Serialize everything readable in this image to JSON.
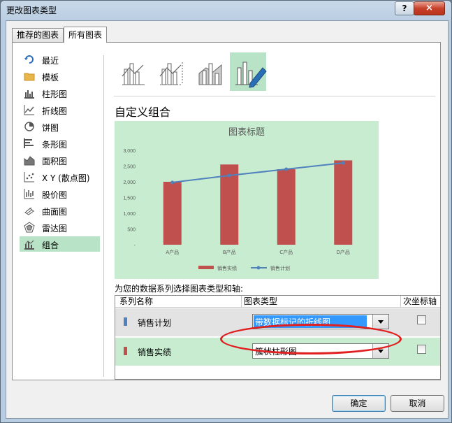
{
  "window": {
    "title": "更改图表类型",
    "help_label": "?",
    "close_label": "×"
  },
  "tabs": [
    {
      "label": "推荐的图表",
      "active": false
    },
    {
      "label": "所有图表",
      "active": true
    }
  ],
  "categories": [
    {
      "label": "最近",
      "icon": "recent-icon"
    },
    {
      "label": "模板",
      "icon": "folder-icon"
    },
    {
      "label": "柱形图",
      "icon": "column-chart-icon"
    },
    {
      "label": "折线图",
      "icon": "line-chart-icon"
    },
    {
      "label": "饼图",
      "icon": "pie-chart-icon"
    },
    {
      "label": "条形图",
      "icon": "bar-chart-icon"
    },
    {
      "label": "面积图",
      "icon": "area-chart-icon"
    },
    {
      "label": "X Y (散点图)",
      "icon": "scatter-chart-icon"
    },
    {
      "label": "股价图",
      "icon": "stock-chart-icon"
    },
    {
      "label": "曲面图",
      "icon": "surface-chart-icon"
    },
    {
      "label": "雷达图",
      "icon": "radar-chart-icon"
    },
    {
      "label": "组合",
      "icon": "combo-chart-icon",
      "selected": true
    }
  ],
  "subtypes": [
    "combo-column-line-icon",
    "combo-column-line-secondary-icon",
    "combo-area-column-icon",
    "custom-combo-icon"
  ],
  "section_title": "自定义组合",
  "chart_data": {
    "type": "bar",
    "title": "图表标题",
    "categories": [
      "A产品",
      "B产品",
      "C产品",
      "D产品"
    ],
    "series": [
      {
        "name": "销售实绩",
        "type": "bar",
        "values": [
          2000,
          2550,
          2400,
          2680
        ],
        "color": "#c0504d"
      },
      {
        "name": "销售计划",
        "type": "line",
        "values": [
          1980,
          2200,
          2400,
          2600
        ],
        "color": "#4f81bd"
      }
    ],
    "ylim": [
      0,
      3000
    ],
    "yticks": [
      "3,000",
      "2,500",
      "2,000",
      "1,500",
      "1,000",
      "500",
      "-"
    ],
    "legend": "bottom",
    "background": "#c8ecd0"
  },
  "series_prompt": "为您的数据系列选择图表类型和轴:",
  "series_table": {
    "headers": [
      "系列名称",
      "图表类型",
      "次坐标轴"
    ],
    "rows": [
      {
        "name": "销售计划",
        "color": "#4f81bd",
        "chart_type": "带数据标记的折线图",
        "secondary": false
      },
      {
        "name": "销售实绩",
        "color": "#c0504d",
        "chart_type": "簇状柱形图",
        "secondary": false
      }
    ]
  },
  "buttons": {
    "ok": "确定",
    "cancel": "取消"
  }
}
